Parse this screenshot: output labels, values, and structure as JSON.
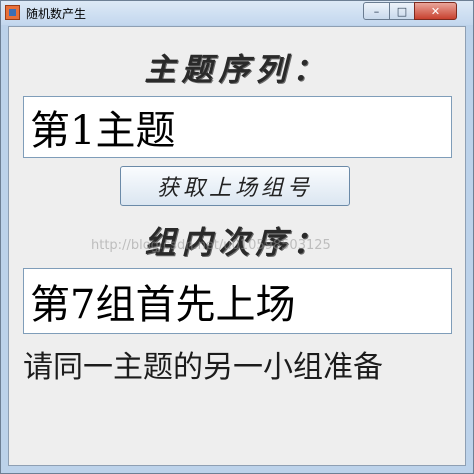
{
  "window": {
    "title": "随机数产生",
    "controls": {
      "minimize": "–",
      "maximize": "□",
      "close": "✕"
    }
  },
  "topic": {
    "heading": "主题序列：",
    "value": "第1主题"
  },
  "draw_button": {
    "label": "获取上场组号"
  },
  "order": {
    "heading": "组内次序：",
    "value": "第7组首先上场"
  },
  "message": "请同一主题的另一小组准备",
  "watermark": "http://blog.csdn.net/u010598503125",
  "icons": {
    "app": "app-icon",
    "minimize": "minimize-icon",
    "maximize": "maximize-icon",
    "close": "close-icon"
  }
}
